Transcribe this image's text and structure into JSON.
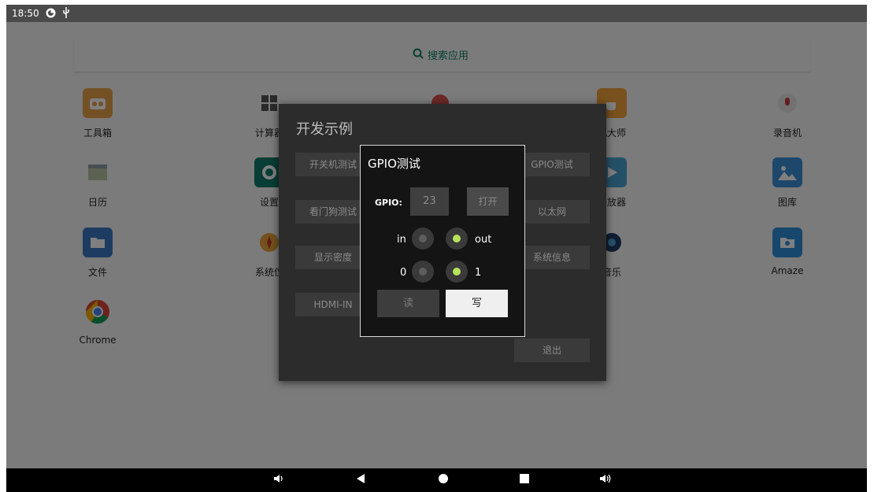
{
  "status": {
    "time": "18:50",
    "icons": [
      "android-debug-icon",
      "usb-icon"
    ]
  },
  "search": {
    "placeholder": "搜索应用",
    "icon": "search-icon"
  },
  "apps": [
    {
      "label": "工具箱",
      "icon": "toolbox-icon",
      "color": "#e9a04a"
    },
    {
      "label": "计算器",
      "icon": "calculator-icon",
      "color": "#555555"
    },
    {
      "label": "",
      "icon": "gem-icon",
      "color": "#d9534f"
    },
    {
      "label": "机大师",
      "icon": "tea-icon",
      "color": "#f0a23c"
    },
    {
      "label": "录音机",
      "icon": "mic-icon",
      "color": "#e4e4e4"
    },
    {
      "label": "日历",
      "icon": "calendar-icon",
      "color": "#8fa0a8"
    },
    {
      "label": "设置",
      "icon": "gear-icon",
      "color": "#117d6c"
    },
    {
      "label": "播放器",
      "icon": "play-icon",
      "color": "#4aa3d0"
    },
    {
      "label": "图库",
      "icon": "image-icon",
      "color": "#3a8fd6"
    },
    {
      "label": "文件",
      "icon": "folder-icon",
      "color": "#3d79c5"
    },
    {
      "label": "系统仪",
      "icon": "compass-icon",
      "color": "#e8a23a"
    },
    {
      "label": "音乐",
      "icon": "music-icon",
      "color": "#1f3d66"
    },
    {
      "label": "Amaze",
      "icon": "folder-search-icon",
      "color": "#2f8ed8"
    },
    {
      "label": "Chrome",
      "icon": "chrome-icon",
      "color": "#4285f4"
    }
  ],
  "dev_dialog": {
    "title": "开发示例",
    "buttons": [
      "开关机测试",
      "GPIO测试",
      "看门狗测试",
      "以太网",
      "显示密度",
      "系统信息",
      "HDMI-IN",
      "退出"
    ]
  },
  "gpio_dialog": {
    "title": "GPIO测试",
    "gpio_label": "GPIO:",
    "gpio_value": "23",
    "open_button": "打开",
    "direction": {
      "in_label": "in",
      "out_label": "out",
      "selected": "out"
    },
    "level": {
      "zero_label": "0",
      "one_label": "1",
      "selected": "1"
    },
    "read_button": "读",
    "write_button": "写"
  },
  "navbar": [
    "volume-down-icon",
    "back-icon",
    "home-icon",
    "recents-icon",
    "volume-up-icon"
  ]
}
